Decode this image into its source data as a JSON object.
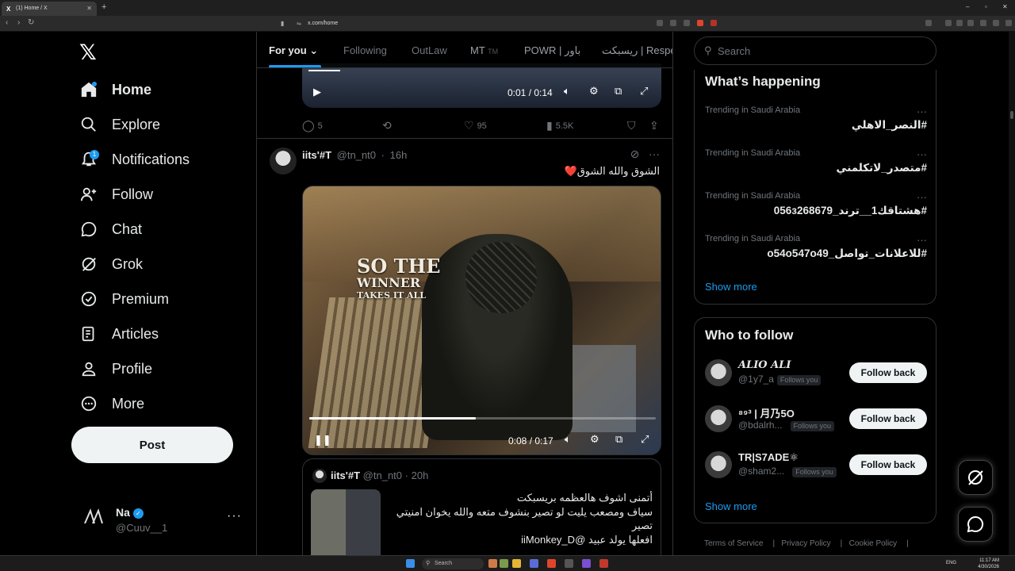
{
  "browser": {
    "tab_title": "(1) Home / X",
    "url": "x.com/home"
  },
  "leftnav": {
    "logo": "𝕏",
    "items": [
      {
        "label": "Home"
      },
      {
        "label": "Explore"
      },
      {
        "label": "Notifications",
        "badge": "1"
      },
      {
        "label": "Follow"
      },
      {
        "label": "Chat"
      },
      {
        "label": "Grok"
      },
      {
        "label": "Premium"
      },
      {
        "label": "Articles"
      },
      {
        "label": "Profile"
      },
      {
        "label": "More"
      }
    ],
    "post_label": "Post",
    "account": {
      "name": "Na",
      "handle": "@Cuuv__1"
    }
  },
  "feed": {
    "tabs": [
      "For you",
      "Following",
      "OutLaw",
      "MT",
      "POWR | باور",
      "ريسبكت | Respe"
    ],
    "tab_mt_suffix": "TM",
    "prev_video": {
      "time": "0:01 / 0:14"
    },
    "prev_actions": {
      "replies": "5",
      "likes": "95",
      "views": "5.5K"
    },
    "tweet": {
      "name": "iits'#T",
      "handle": "@tn_nt0",
      "age": "16h",
      "text": "الشوق والله الشوق❤️",
      "video_time": "0:08 / 0:17",
      "progress": 0.48,
      "overlay_line1": "SO THE",
      "overlay_line2": "WINNER",
      "overlay_line3": "TAKES IT ALL"
    },
    "quote": {
      "name": "iits'#T",
      "handle": "@tn_nt0",
      "age": "20h",
      "line1": "أتمنى اشوف هالعظمه بريسبكت",
      "line2": "سياف ومصعب يليت لو تصير بنشوف متعه والله يخوان امنيتي تصير",
      "line3": "افعلها يولد عبيد @iiMonkey_D"
    }
  },
  "right": {
    "search_placeholder": "Search",
    "happening_title": "What’s happening",
    "trends": [
      {
        "context": "Trending in Saudi Arabia",
        "tag": "#النصر_الاهلي"
      },
      {
        "context": "Trending in Saudi Arabia",
        "tag": "#متصدر_لاتكلمني"
      },
      {
        "context": "Trending in Saudi Arabia",
        "tag": "#هشتاقك1__ترند_056з268679"
      },
      {
        "context": "Trending in Saudi Arabia",
        "tag": "#للاعلانات_تواصل_o54o547o49"
      }
    ],
    "show_more": "Show more",
    "wtf_title": "Who to follow",
    "follows": [
      {
        "name": "ALIO ALI",
        "handle": "@1y7_a",
        "follows_you": "Follows you",
        "button": "Follow back"
      },
      {
        "name": "⁸⁹³ | 月乃5O",
        "handle": "@bdalrh...",
        "follows_you": "Follows you",
        "button": "Follow back"
      },
      {
        "name": "TR|S7ADE⚛",
        "handle": "@sham2...",
        "follows_you": "Follows you",
        "button": "Follow back"
      }
    ],
    "footer": [
      "Terms of Service",
      "Privacy Policy",
      "Cookie Policy"
    ]
  },
  "taskbar": {
    "search": "Search",
    "lang": "ENG",
    "time": "11:17 AM",
    "date": "4/30/2026"
  }
}
